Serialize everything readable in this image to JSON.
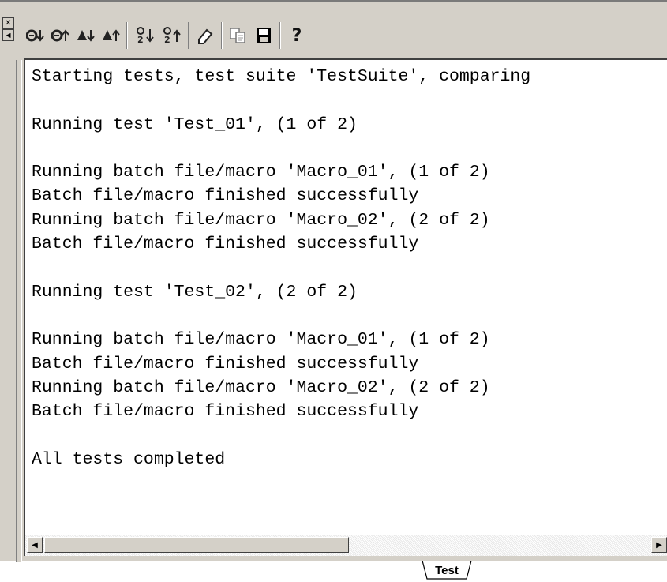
{
  "toolbar": {
    "buttons": [
      {
        "icon": "sort-errors-descending-icon",
        "glyph": "⊖↓"
      },
      {
        "icon": "sort-errors-ascending-icon",
        "glyph": "⊖↑"
      },
      {
        "icon": "sort-warnings-descending-icon",
        "glyph": "▲↓"
      },
      {
        "icon": "sort-warnings-ascending-icon",
        "glyph": "▲↑"
      },
      {
        "icon": "sort-info-descending-icon",
        "glyph": "ℹ↓"
      },
      {
        "icon": "sort-info-ascending-icon",
        "glyph": "ℹ↑"
      },
      {
        "icon": "eraser-icon",
        "glyph": "⌀"
      },
      {
        "icon": "copy-icon",
        "glyph": "⎘"
      },
      {
        "icon": "save-icon",
        "glyph": "💾"
      },
      {
        "icon": "help-icon",
        "glyph": "?"
      }
    ]
  },
  "output": {
    "lines": [
      "Starting tests, test suite 'TestSuite', comparing",
      "",
      "Running test 'Test_01', (1 of 2)",
      "",
      "Running batch file/macro 'Macro_01', (1 of 2)",
      "Batch file/macro finished successfully",
      "Running batch file/macro 'Macro_02', (2 of 2)",
      "Batch file/macro finished successfully",
      "",
      "Running test 'Test_02', (2 of 2)",
      "",
      "Running batch file/macro 'Macro_01', (1 of 2)",
      "Batch file/macro finished successfully",
      "Running batch file/macro 'Macro_02', (2 of 2)",
      "Batch file/macro finished successfully",
      "",
      "All tests completed"
    ]
  },
  "tabs": {
    "active_label": "Test"
  },
  "colors": {
    "chrome": "#d4d0c8",
    "text": "#000000",
    "panel": "#ffffff"
  }
}
